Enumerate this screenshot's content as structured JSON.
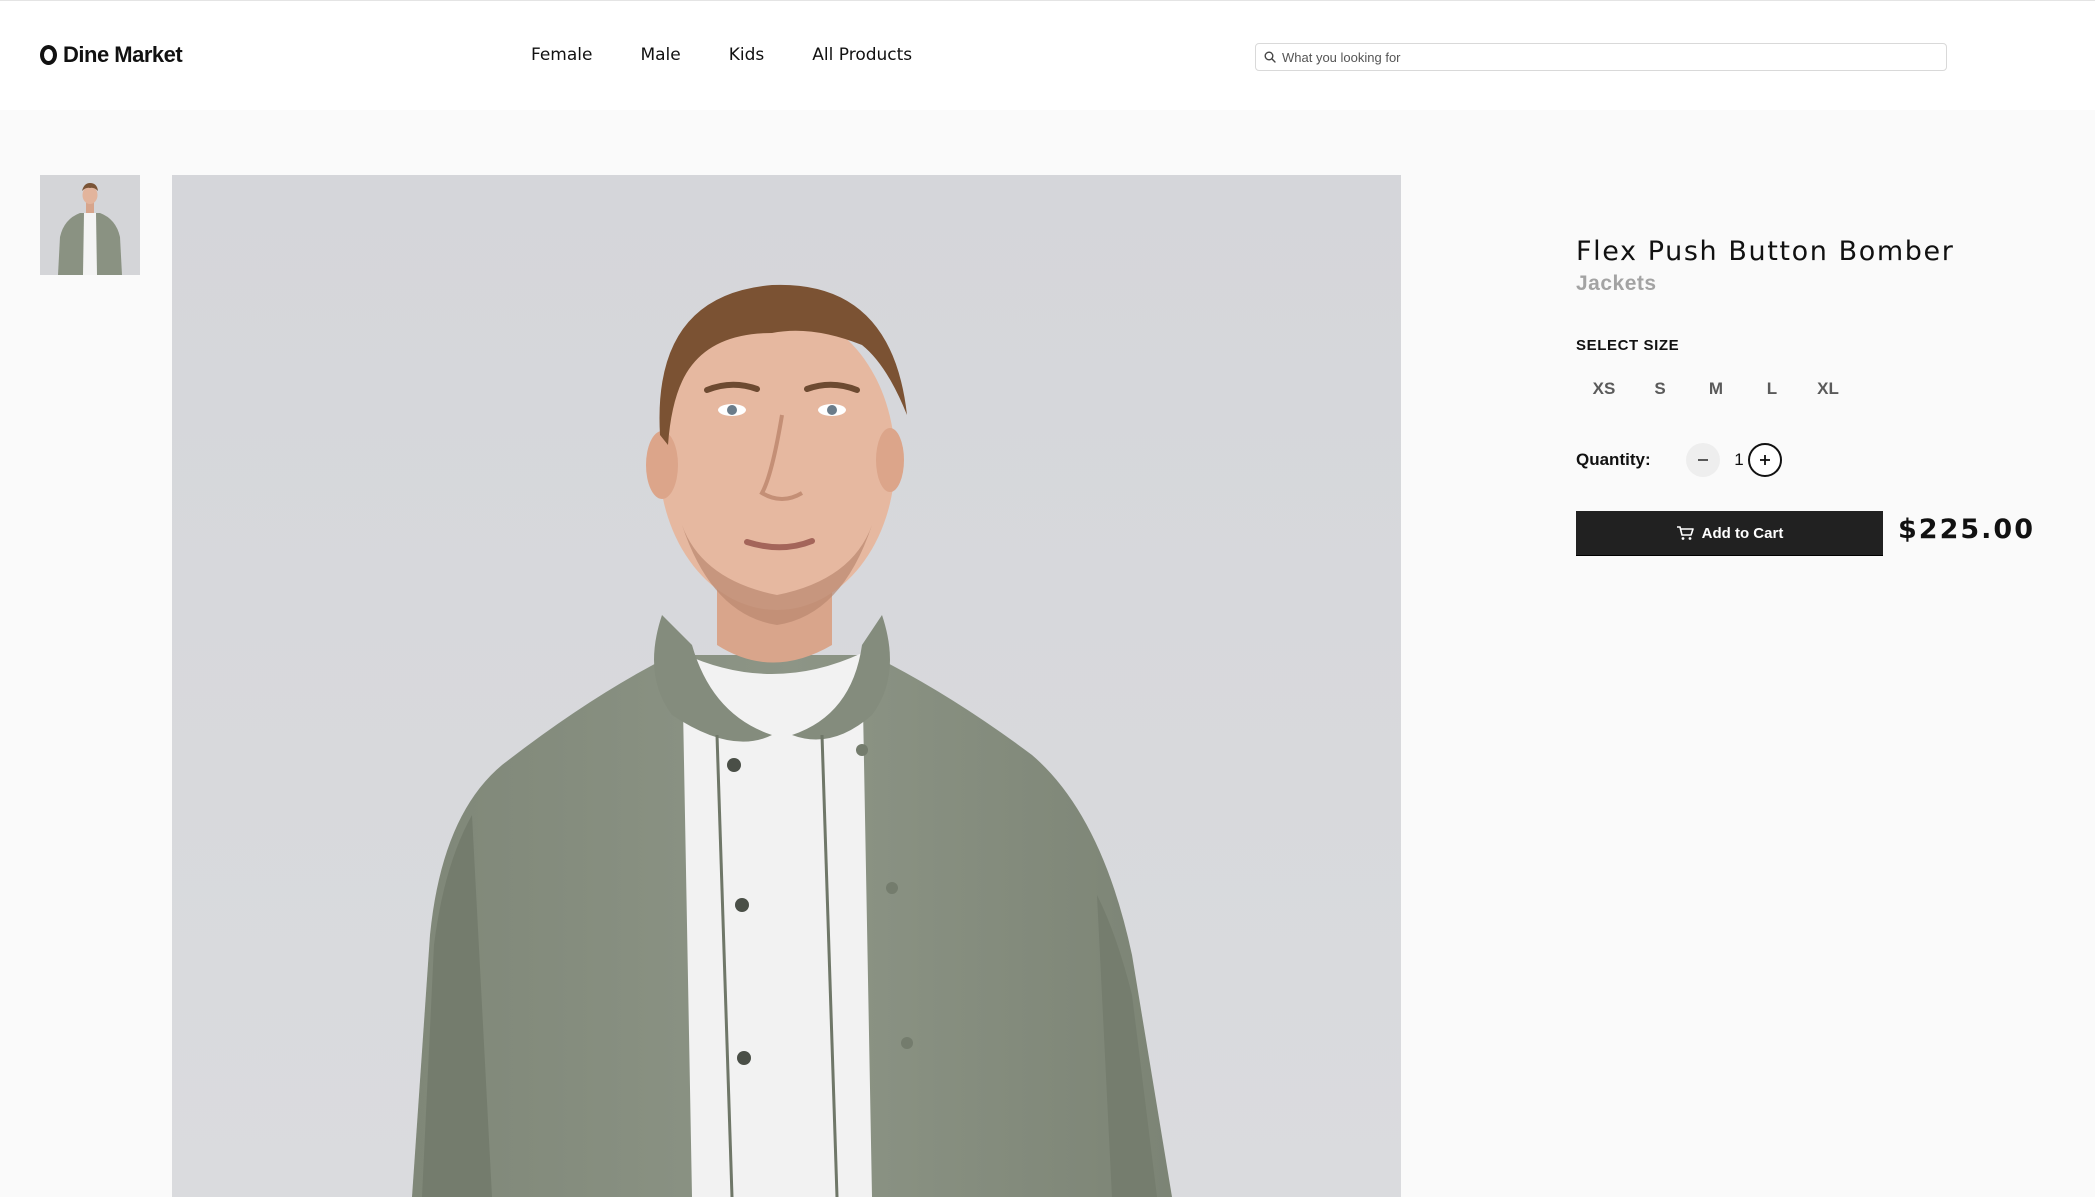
{
  "header": {
    "logo_text": "Dine Market",
    "nav": [
      {
        "label": "Female"
      },
      {
        "label": "Male"
      },
      {
        "label": "Kids"
      },
      {
        "label": "All Products"
      }
    ],
    "search": {
      "placeholder": "What you looking for",
      "value": ""
    }
  },
  "product": {
    "title": "Flex Push Button Bomber",
    "category": "Jackets",
    "size_label": "SELECT SIZE",
    "sizes": [
      "XS",
      "S",
      "M",
      "L",
      "XL"
    ],
    "quantity_label": "Quantity:",
    "quantity": "1",
    "add_to_cart_label": "Add to Cart",
    "price": "$225.00"
  },
  "colors": {
    "jacket": "#8a9282",
    "backdrop": "#d7d8dc",
    "button": "#212121",
    "category": "#a3a3a3"
  },
  "icons": [
    "logo-mark-icon",
    "search-icon",
    "minus-icon",
    "plus-icon",
    "cart-icon"
  ]
}
